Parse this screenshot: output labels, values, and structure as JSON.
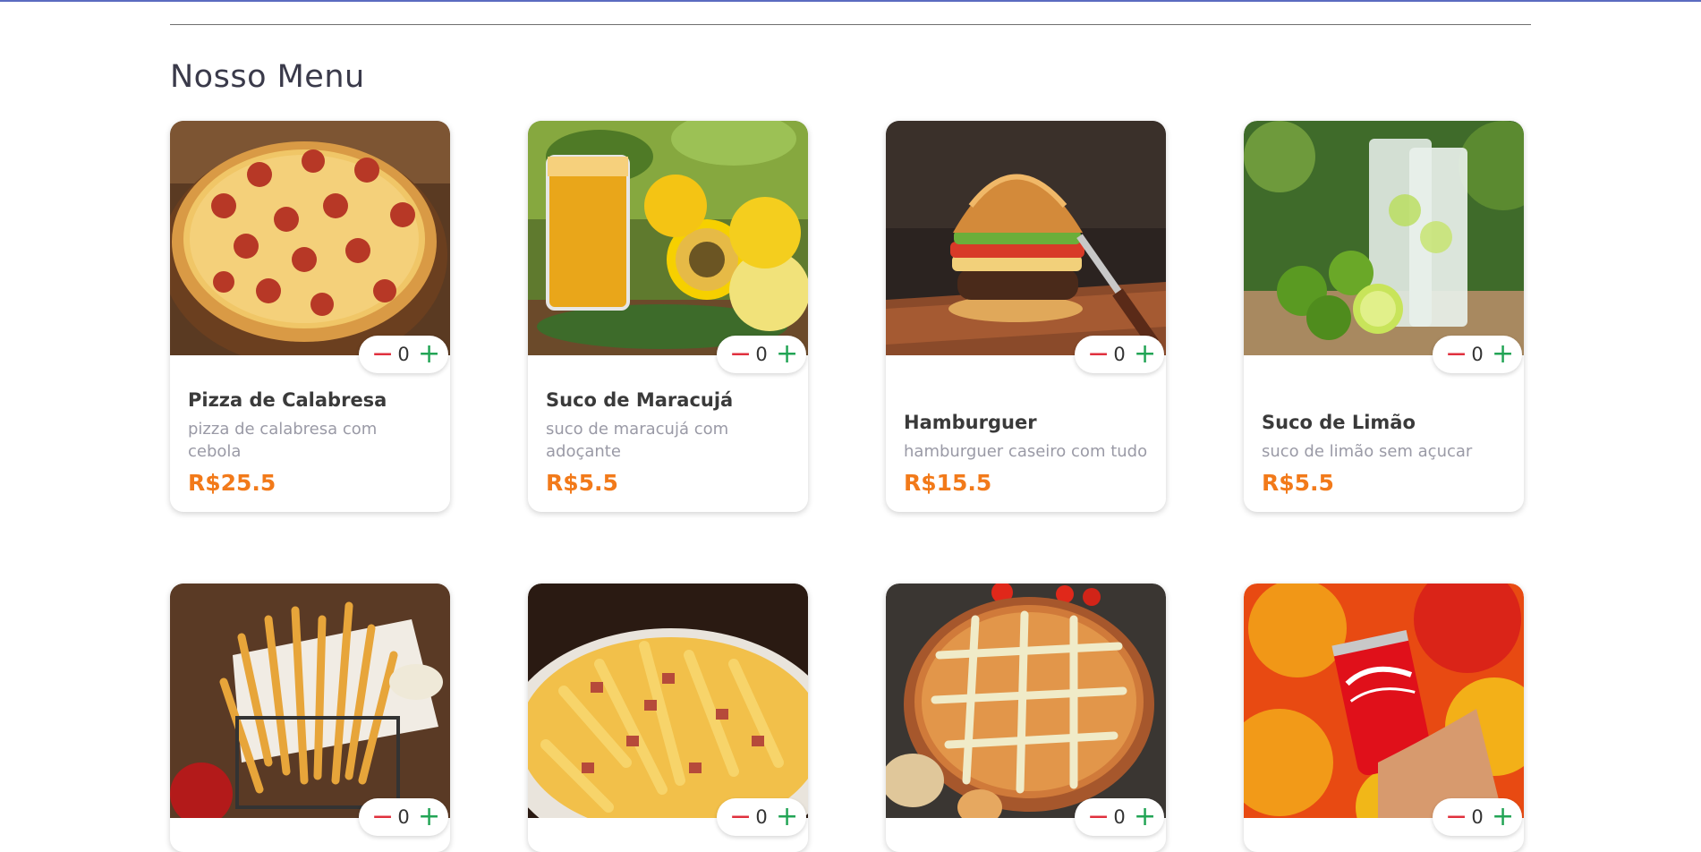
{
  "menu": {
    "title": "Nosso Menu",
    "items": [
      {
        "name": "Pizza de Calabresa",
        "description": "pizza de calabresa com cebola",
        "price": "R$25.5",
        "quantity": "0",
        "image": "pizza-pepperoni"
      },
      {
        "name": "Suco de Maracujá",
        "description": "suco de maracujá com adoçante",
        "price": "R$5.5",
        "quantity": "0",
        "image": "passion-fruit-juice"
      },
      {
        "name": "Hamburguer",
        "description": "hamburguer caseiro com tudo",
        "price": "R$15.5",
        "quantity": "0",
        "image": "hamburger"
      },
      {
        "name": "Suco de Limão",
        "description": "suco de limão sem açucar",
        "price": "R$5.5",
        "quantity": "0",
        "image": "lime-juice"
      },
      {
        "quantity": "0",
        "image": "french-fries-basket"
      },
      {
        "quantity": "0",
        "image": "cheese-bacon-fries"
      },
      {
        "quantity": "0",
        "image": "chicken-pizza"
      },
      {
        "quantity": "0",
        "image": "coca-cola-can"
      }
    ]
  },
  "stepper": {
    "minus": "−",
    "plus": "+"
  },
  "colors": {
    "accent": "#f27a1a",
    "minus": "#e0303e",
    "plus": "#22a455",
    "top_bar": "#5b6bc0"
  }
}
